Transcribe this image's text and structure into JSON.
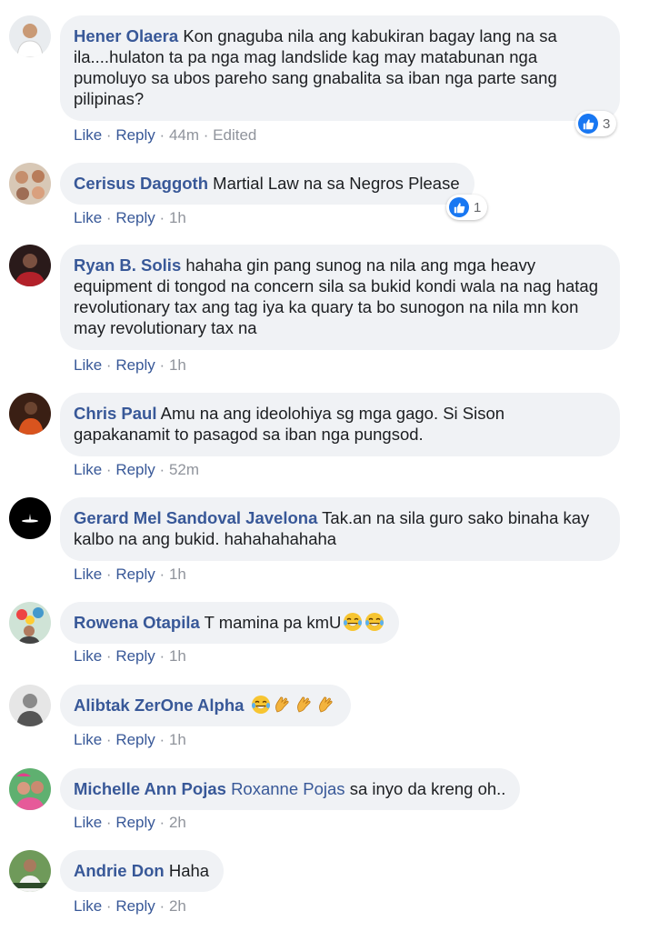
{
  "action_labels": {
    "like": "Like",
    "reply": "Reply",
    "separator": "·",
    "edited": "Edited"
  },
  "comments": [
    {
      "author": "Hener Olaera",
      "text": "Kon gnaguba nila ang kabukiran bagay lang na sa ila....hulaton ta pa nga mag landslide kag may matabunan nga pumoluyo sa ubos pareho sang gnabalita sa iban nga parte sang pilipinas?",
      "time": "44m",
      "reaction_count": "3"
    },
    {
      "author": "Cerisus Daggoth",
      "text": "Martial Law na sa Negros Please",
      "time": "1h",
      "reaction_count": "1"
    },
    {
      "author": "Ryan B. Solis",
      "text": "hahaha gin pang sunog na nila ang mga heavy equipment di tongod na concern sila sa bukid kondi wala na nag hatag revolutionary tax ang tag iya ka quary ta bo sunogon na nila mn kon may revolutionary tax na",
      "time": "1h"
    },
    {
      "author": "Chris Paul",
      "text": "Amu na ang ideolohiya sg mga gago. Si Sison gapakanamit to pasagod sa iban nga pungsod.",
      "time": "52m"
    },
    {
      "author": "Gerard Mel Sandoval Javelona",
      "text": "Tak.an na sila guro sako binaha kay kalbo na ang bukid. hahahahahaha",
      "time": "1h"
    },
    {
      "author": "Rowena Otapila",
      "text": "T mamina pa kmU",
      "emojis": [
        "laughing-tears-emoji",
        "laughing-tears-emoji"
      ],
      "time": "1h"
    },
    {
      "author": "Alibtak ZerOne Alpha",
      "text": "",
      "emojis": [
        "laughing-tears-emoji",
        "clapping-hands-emoji",
        "clapping-hands-emoji",
        "clapping-hands-emoji"
      ],
      "time": "1h"
    },
    {
      "author": "Michelle Ann Pojas",
      "tag": "Roxanne Pojas",
      "text": "sa inyo da kreng oh..",
      "time": "2h"
    },
    {
      "author": "Andrie Don",
      "text": "Haha",
      "time": "2h"
    }
  ],
  "colors": {
    "author": "#385898",
    "bubble": "#f0f2f5",
    "like_blue": "#1877f2",
    "meta_gray": "#90949c"
  }
}
